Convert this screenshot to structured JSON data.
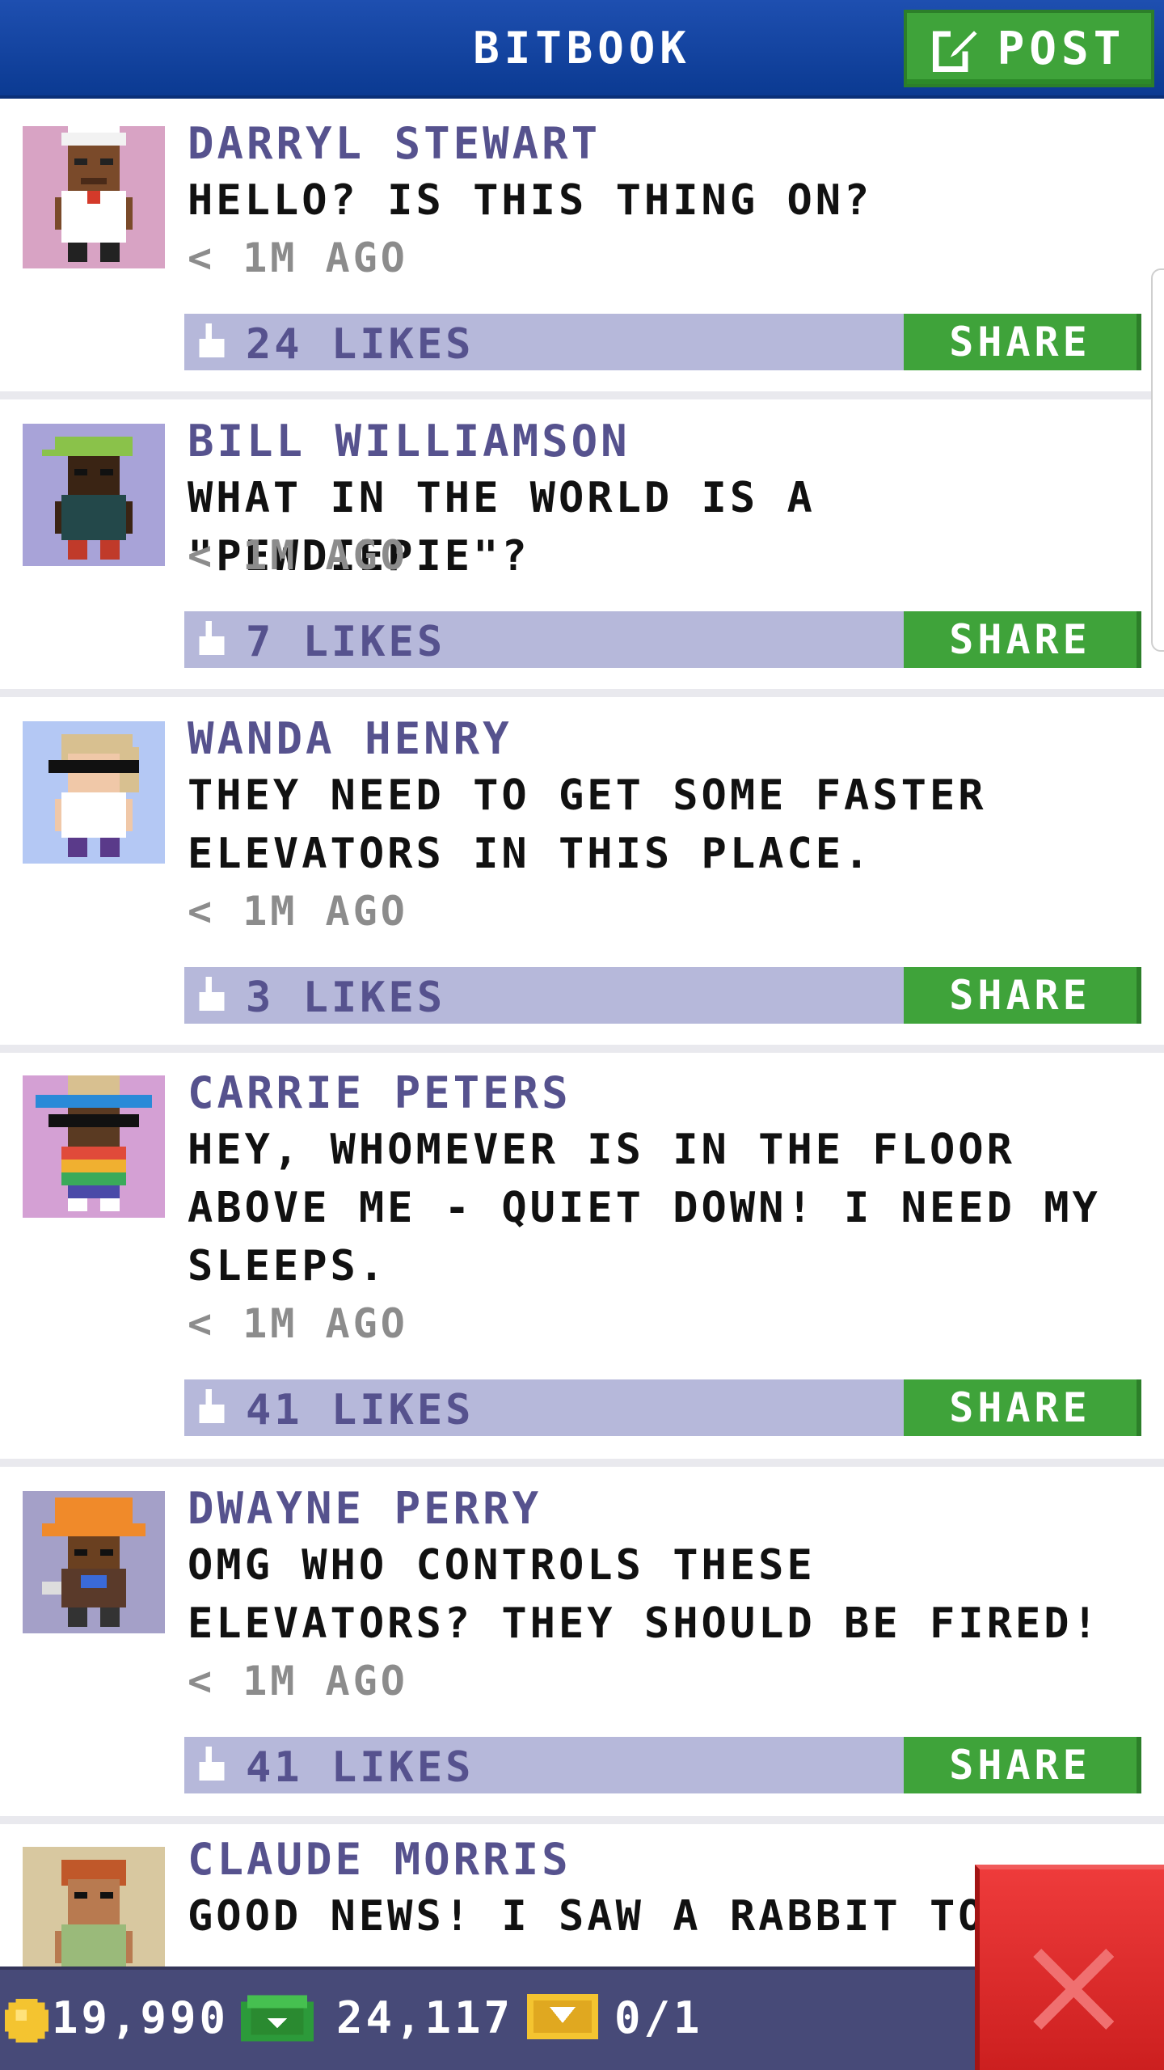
{
  "header": {
    "title": "BITBOOK",
    "post_label": "POST"
  },
  "posts": [
    {
      "author": "DARRYL STEWART",
      "message": "HELLO? IS THIS THING ON?",
      "time": "< 1M AGO",
      "likes": "24 LIKES",
      "share": "SHARE",
      "avatar_bg": "#d8a3c4"
    },
    {
      "author": "BILL WILLIAMSON",
      "message": "WHAT IN THE WORLD IS A \"PEWDIEPIE\"?",
      "time": "< 1M AGO",
      "likes": "7 LIKES",
      "share": "SHARE",
      "avatar_bg": "#a8a3d8"
    },
    {
      "author": "WANDA HENRY",
      "message": "THEY NEED TO GET SOME FASTER ELEVATORS IN THIS PLACE.",
      "time": "< 1M AGO",
      "likes": "3 LIKES",
      "share": "SHARE",
      "avatar_bg": "#b4c8f4"
    },
    {
      "author": "CARRIE PETERS",
      "message": "HEY, WHOMEVER IS IN THE FLOOR ABOVE ME - QUIET DOWN! I NEED MY SLEEPS.",
      "time": "< 1M AGO",
      "likes": "41 LIKES",
      "share": "SHARE",
      "avatar_bg": "#d4a0d4"
    },
    {
      "author": "DWAYNE PERRY",
      "message": "OMG WHO CONTROLS THESE ELEVATORS? THEY SHOULD BE FIRED!",
      "time": "< 1M AGO",
      "likes": "41 LIKES",
      "share": "SHARE",
      "avatar_bg": "#a4a0c8"
    },
    {
      "author": "CLAUDE MORRIS",
      "message": "GOOD NEWS! I SAW A RABBIT TOD",
      "time": "",
      "likes": "",
      "share": "",
      "avatar_bg": "#d8c8a0"
    }
  ],
  "bottom": {
    "coins": "19,990",
    "bux": "24,117",
    "tickets": "0/1"
  },
  "colors": {
    "header": "#1e4fb0",
    "accent_green": "#3fa33a",
    "like_bar": "#b6b8da",
    "author_text": "#56528e",
    "close_red": "#e02b2b",
    "bottom_bar": "#474a78"
  },
  "icons": [
    "compose-icon",
    "thumbs-up-icon",
    "coin-icon",
    "bux-icon",
    "ticket-icon",
    "close-icon"
  ]
}
